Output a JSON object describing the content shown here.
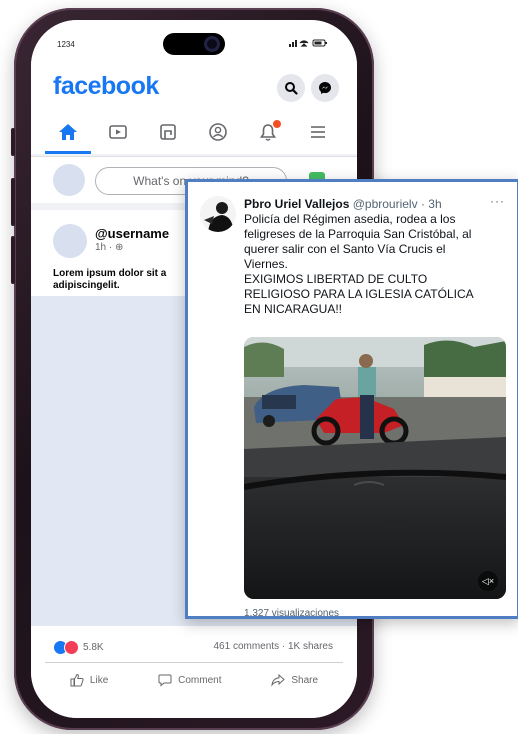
{
  "status_bar": {
    "time": "1234"
  },
  "facebook": {
    "logo": "facebook",
    "header_icons": [
      "search-icon",
      "messenger-icon"
    ],
    "nav_icons": [
      "home-icon",
      "watch-icon",
      "marketplace-icon",
      "profile-icon",
      "notifications-icon",
      "menu-icon"
    ],
    "composer": {
      "placeholder": "What's on your mind?"
    },
    "post": {
      "username": "@username",
      "meta": "1h · ",
      "body": "Lorem ipsum dolor sit a adipiscingelit.",
      "reactions_count": "5.8K",
      "comments_shares": "461 comments · 1K shares",
      "actions": [
        "Like",
        "Comment",
        "Share"
      ]
    }
  },
  "tweet": {
    "author_name": "Pbro Uriel Vallejos",
    "author_handle": "@pbrourielv",
    "time": "· 3h",
    "more": "···",
    "text_lines": [
      "Policía del Régimen asedia, rodea a los",
      "feligreses de la Parroquia San Cristóbal, al",
      "querer salir con el Santo Vía Crucis el",
      "Viernes.",
      "EXIGIMOS LIBERTAD DE CULTO",
      "RELIGIOSO PARA LA IGLESIA CATÓLICA",
      "EN NICARAGUA!!"
    ],
    "views": "1.327 visualizaciones"
  },
  "colors": {
    "facebook_blue": "#1877f2",
    "tweet_frame": "#4f7ec3",
    "phone_frame": "#2b1a26"
  }
}
